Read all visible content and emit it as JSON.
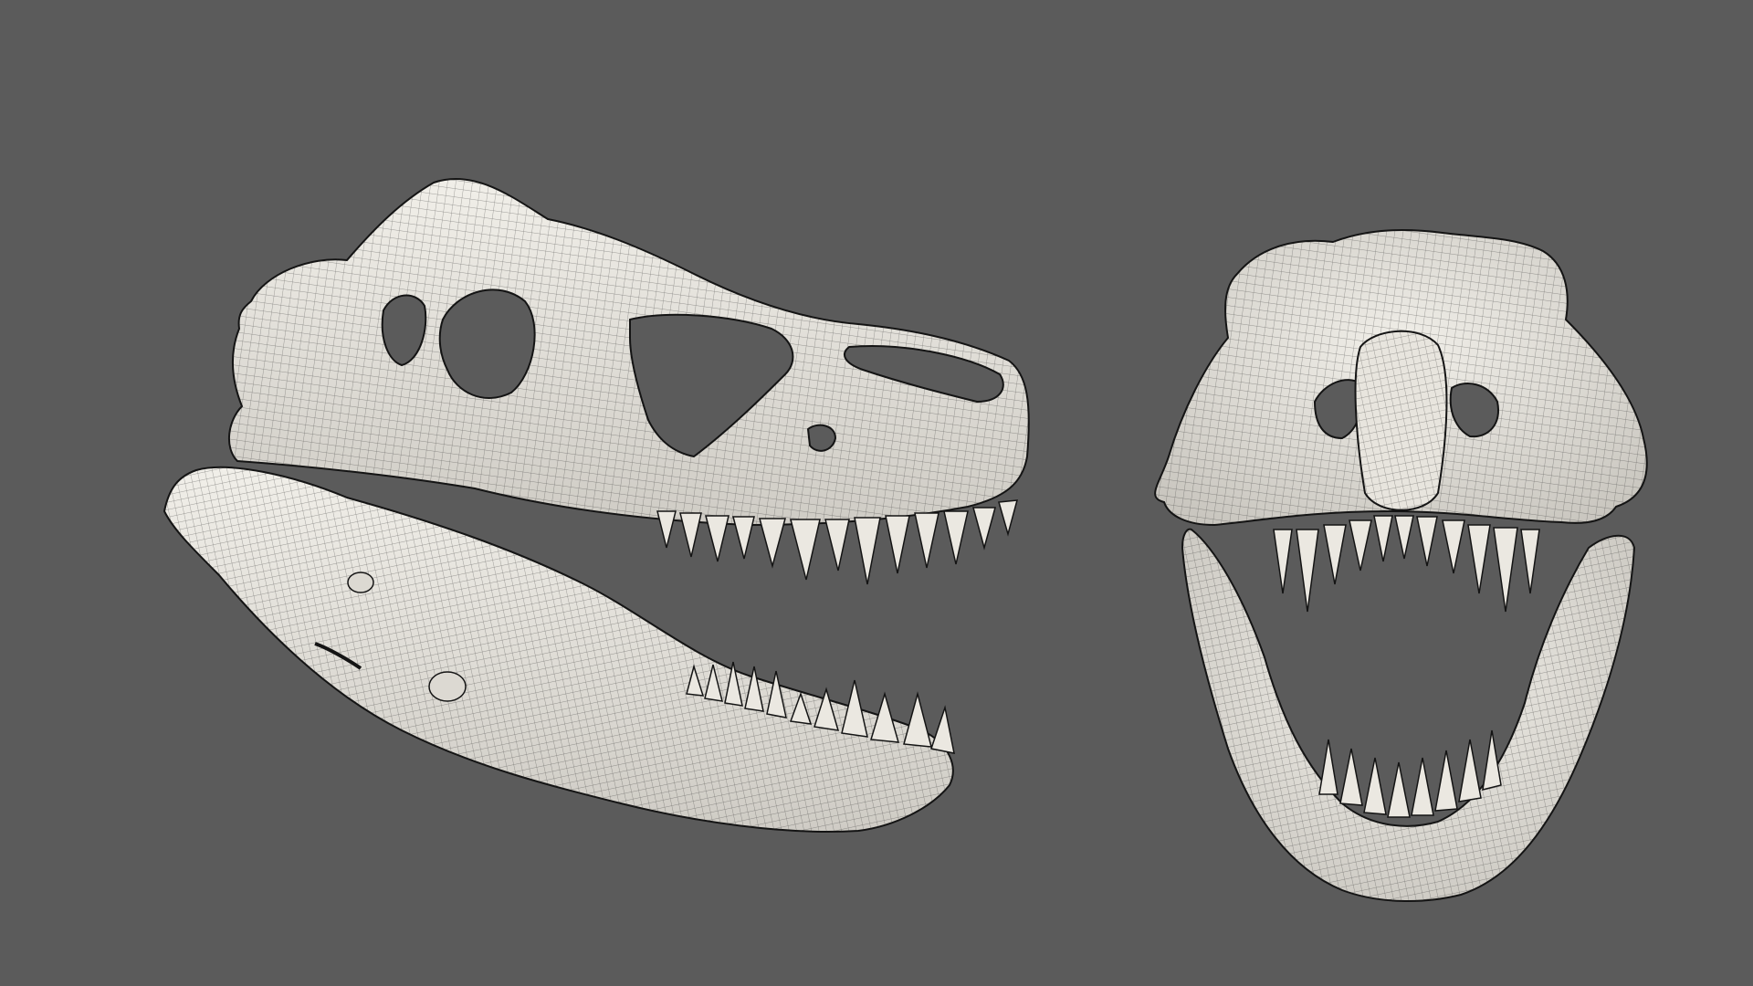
{
  "scene": {
    "background_color": "#5b5b5b",
    "mesh_fill_color": "#e9e6df",
    "mesh_shadow_color": "#bdbab3",
    "wireframe_color": "#2b2b2b",
    "outline_color": "#141414",
    "objects": [
      {
        "name": "trex-skull-side-view",
        "view": "side"
      },
      {
        "name": "trex-skull-front-view",
        "view": "front"
      }
    ]
  }
}
